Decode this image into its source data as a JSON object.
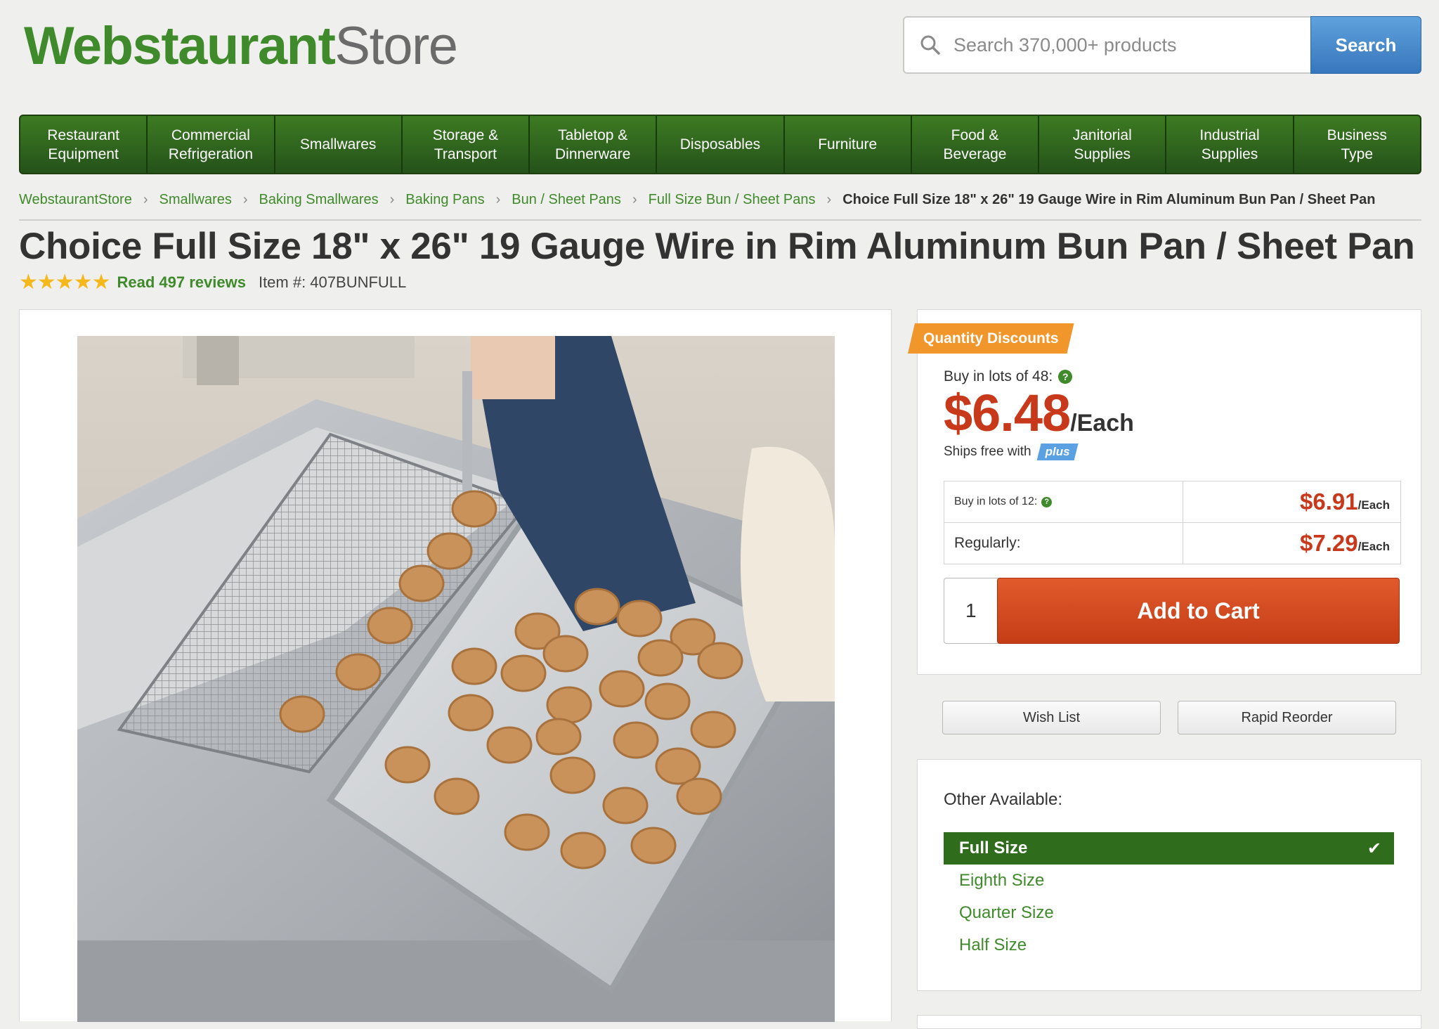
{
  "header": {
    "logo_part1": "Webstaurant",
    "logo_part2": "Store",
    "search_placeholder": "Search 370,000+ products",
    "search_button": "Search"
  },
  "nav": {
    "items": [
      {
        "label": "Restaurant\nEquipment"
      },
      {
        "label": "Commercial\nRefrigeration"
      },
      {
        "label": "Smallwares"
      },
      {
        "label": "Storage &\nTransport"
      },
      {
        "label": "Tabletop &\nDinnerware"
      },
      {
        "label": "Disposables"
      },
      {
        "label": "Furniture"
      },
      {
        "label": "Food &\nBeverage"
      },
      {
        "label": "Janitorial\nSupplies"
      },
      {
        "label": "Industrial\nSupplies"
      },
      {
        "label": "Business\nType"
      }
    ]
  },
  "breadcrumb": {
    "items": [
      "WebstaurantStore",
      "Smallwares",
      "Baking Smallwares",
      "Baking Pans",
      "Bun / Sheet Pans",
      "Full Size Bun / Sheet Pans"
    ],
    "current": "Choice Full Size 18\" x 26\" 19 Gauge Wire in Rim Aluminum Bun Pan / Sheet Pan"
  },
  "product": {
    "title": "Choice Full Size 18\" x 26\" 19 Gauge Wire in Rim Aluminum Bun Pan / Sheet Pan",
    "stars": "★★★★★",
    "rating": 5,
    "reviews_label": "Read 497 reviews",
    "item_number": "Item #: 407BUNFULL"
  },
  "pricing": {
    "discount_tag": "Quantity Discounts",
    "lots48_label": "Buy in lots of 48:",
    "price": "$6.48",
    "price_unit": "/Each",
    "ships_free": "Ships free with",
    "plus_label": "plus",
    "tiers": [
      {
        "label": "Buy in lots of 12:",
        "price": "$6.91",
        "unit": "/Each"
      },
      {
        "label": "Regularly:",
        "price": "$7.29",
        "unit": "/Each"
      }
    ],
    "quantity": "1",
    "add_to_cart": "Add to Cart"
  },
  "actions": {
    "wish_list": "Wish List",
    "rapid_reorder": "Rapid Reorder"
  },
  "other_available": {
    "title": "Other Available:",
    "items": [
      {
        "label": "Full Size",
        "selected": true
      },
      {
        "label": "Eighth Size",
        "selected": false
      },
      {
        "label": "Quarter Size",
        "selected": false
      },
      {
        "label": "Half Size",
        "selected": false
      }
    ]
  },
  "colors": {
    "brand_green": "#3f8a2a",
    "price_red": "#c8381a",
    "search_blue": "#3776bd",
    "discount_orange": "#f0962a",
    "stars_gold": "#f4b81c"
  },
  "icons": {
    "search": "search-icon",
    "help": "question-icon",
    "check": "checkmark-icon",
    "breadcrumb_separator": "chevron-right-icon",
    "star": "star-icon"
  }
}
